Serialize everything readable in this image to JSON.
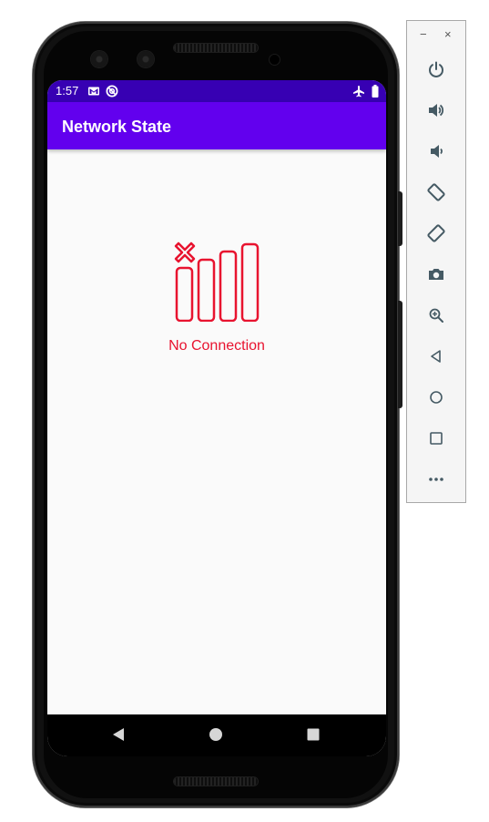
{
  "status_bar": {
    "time": "1:57",
    "left_icons": [
      "gmail-icon",
      "sync-icon"
    ],
    "right_icons": [
      "airplane-mode-icon",
      "battery-icon"
    ]
  },
  "app_bar": {
    "title": "Network State"
  },
  "main": {
    "icon": "no-signal-icon",
    "message": "No Connection"
  },
  "nav_bar": {
    "buttons": [
      "back-icon",
      "home-icon",
      "recents-icon"
    ]
  },
  "emulator_toolbar": {
    "window_controls": {
      "minimize": "−",
      "close": "×"
    },
    "buttons": [
      "power-icon",
      "volume-up-icon",
      "volume-down-icon",
      "rotate-left-icon",
      "rotate-right-icon",
      "camera-icon",
      "zoom-icon",
      "back-icon",
      "home-icon",
      "overview-icon",
      "more-icon"
    ]
  },
  "colors": {
    "status_bar": "#3700b3",
    "app_bar": "#6200ee",
    "accent_error": "#e8132f",
    "screen_background": "#fafafa"
  }
}
